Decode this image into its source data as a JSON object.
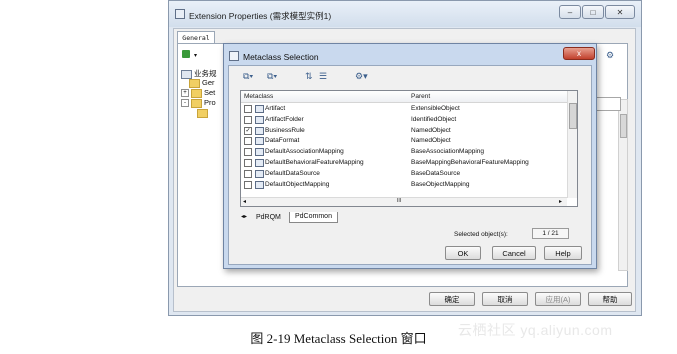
{
  "outer_window": {
    "title": "Extension Properties (需求模型实例1)",
    "tab": "General",
    "tree_root": "业务规",
    "tree_items": [
      "Ger",
      "Set",
      "Pro"
    ],
    "buttons": {
      "ok": "确定",
      "cancel": "取消",
      "apply": "应用(A)",
      "help": "帮助"
    }
  },
  "dialog": {
    "title": "Metaclass Selection",
    "close": "x",
    "columns": [
      "Metaclass",
      "Parent"
    ],
    "rows": [
      {
        "name": "Artifact",
        "parent": "ExtensibleObject",
        "checked": false
      },
      {
        "name": "ArtifactFolder",
        "parent": "IdentifiedObject",
        "checked": false
      },
      {
        "name": "BusinessRule",
        "parent": "NamedObject",
        "checked": true
      },
      {
        "name": "DataFormat",
        "parent": "NamedObject",
        "checked": false
      },
      {
        "name": "DefaultAssociationMapping",
        "parent": "BaseAssociationMapping",
        "checked": false
      },
      {
        "name": "DefaultBehavioralFeatureMapping",
        "parent": "BaseMappingBehavioralFeatureMapping",
        "checked": false
      },
      {
        "name": "DefaultDataSource",
        "parent": "BaseDataSource",
        "checked": false
      },
      {
        "name": "DefaultObjectMapping",
        "parent": "BaseObjectMapping",
        "checked": false
      }
    ],
    "hscroll_mark": "III",
    "tabs": [
      "PdRQM",
      "PdCommon"
    ],
    "selected_label": "Selected object(s):",
    "selected_count": "1 / 21",
    "buttons": {
      "ok": "OK",
      "cancel": "Cancel",
      "help": "Help"
    }
  },
  "caption": "图 2-19    Metaclass Selection 窗口",
  "watermark": "云栖社区 yq.aliyun.com"
}
